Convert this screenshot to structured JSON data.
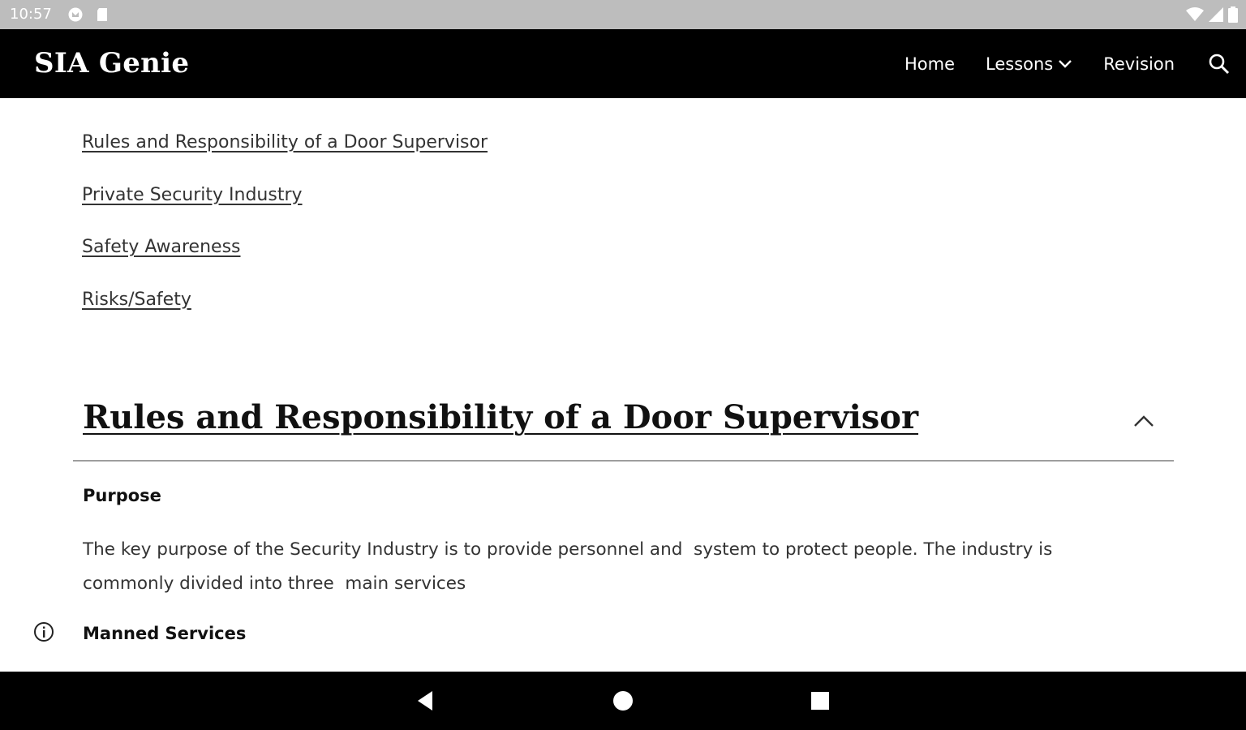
{
  "status_bar": {
    "time": "10:57",
    "left_icons": [
      "gmail-icon",
      "sd-card-icon"
    ],
    "right_icons": [
      "wifi-icon",
      "signal-icon",
      "battery-icon"
    ]
  },
  "header": {
    "site_title": "SIA Genie",
    "nav": {
      "home": "Home",
      "lessons": "Lessons",
      "revision": "Revision"
    },
    "search_icon": "search-icon"
  },
  "toc": [
    "Rules and Responsibility of a Door Supervisor",
    "Private Security Industry",
    "Safety Awareness",
    "Risks/Safety"
  ],
  "section": {
    "heading": "Rules and Responsibility of a Door Supervisor",
    "collapse_icon": "chevron-up-icon",
    "purpose_label": "Purpose",
    "purpose_text": "The key purpose of the Security Industry is to provide personnel and  system to protect people. The industry is commonly divided into three  main services",
    "manned_label": "Manned Services"
  },
  "floating": {
    "info_icon": "info-icon"
  },
  "system_nav": {
    "back_icon": "back-icon",
    "home_icon": "home-icon",
    "recents_icon": "recents-icon"
  }
}
